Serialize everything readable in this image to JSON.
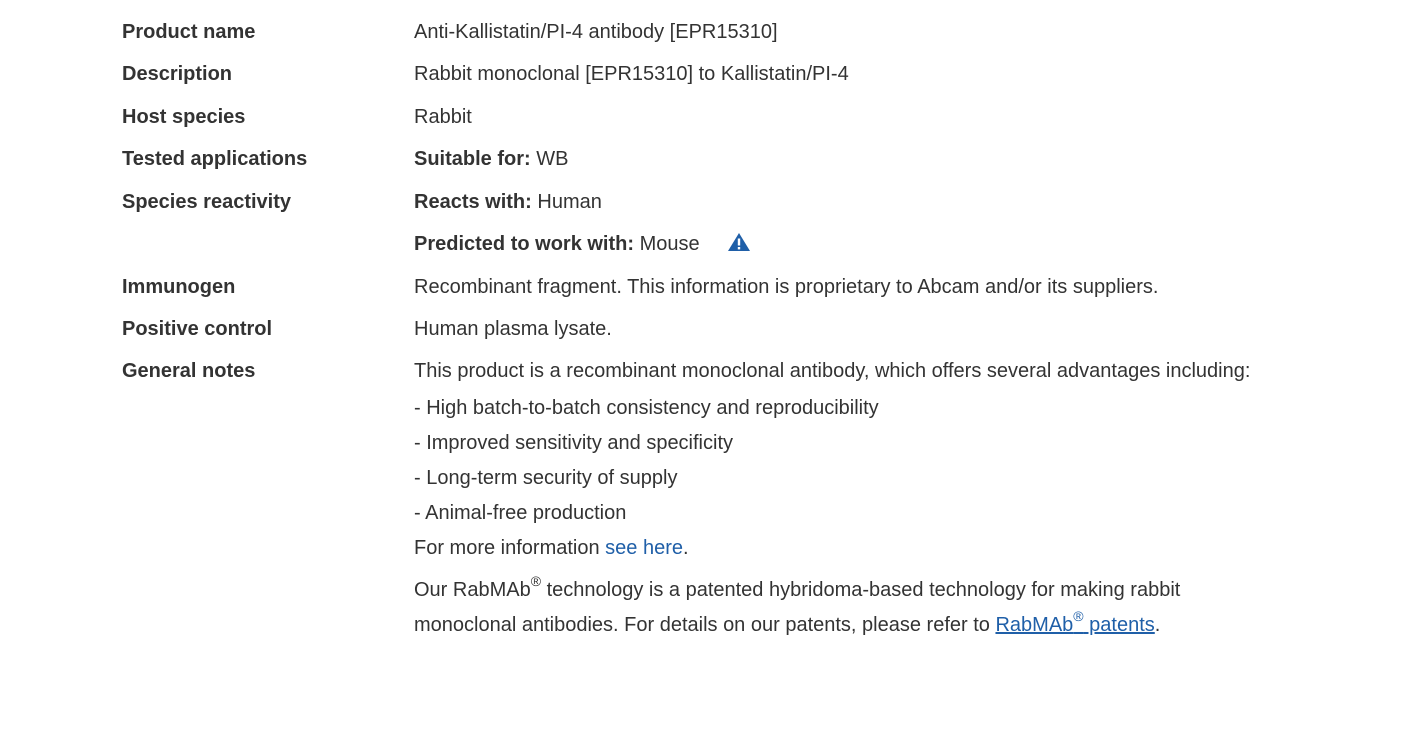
{
  "rows": [
    {
      "label": "Product name",
      "value": "Anti-Kallistatin/PI-4 antibody [EPR15310]"
    },
    {
      "label": "Description",
      "value": "Rabbit monoclonal [EPR15310] to Kallistatin/PI-4"
    },
    {
      "label": "Host species",
      "value": "Rabbit"
    },
    {
      "label": "Tested applications",
      "prefix": "Suitable for:",
      "value": "WB"
    },
    {
      "label": "Species reactivity",
      "prefix": "Reacts with:",
      "value": "Human"
    },
    {
      "label": "Immunogen",
      "value": "Recombinant fragment. This information is proprietary to Abcam and/or its suppliers."
    },
    {
      "label": "Positive control",
      "value": "Human plasma lysate."
    },
    {
      "label": "General notes",
      "value": "This product is a recombinant monoclonal antibody, which offers several advantages including:"
    }
  ],
  "predicted": {
    "prefix": "Predicted to work with:",
    "value": "Mouse",
    "icon": "warning-triangle-icon"
  },
  "advantages": [
    "- High batch-to-batch consistency and reproducibility",
    "- Improved sensitivity and specificity",
    "- Long-term security of supply",
    "- Animal-free production"
  ],
  "more_info": {
    "text": "For more information ",
    "link": "see here",
    "end": "."
  },
  "rabmab": {
    "part1": "Our RabMAb",
    "reg": "®",
    "part2": " technology is a patented hybridoma-based technology for making rabbit",
    "part3": "monoclonal antibodies. For details on our patents, please refer to ",
    "link": "RabMAb",
    "link_reg": "®",
    "link_end": " patents",
    "end": "."
  },
  "colors": {
    "text": "#333333",
    "link": "#1f5fa8",
    "icon": "#1f5fa8"
  }
}
